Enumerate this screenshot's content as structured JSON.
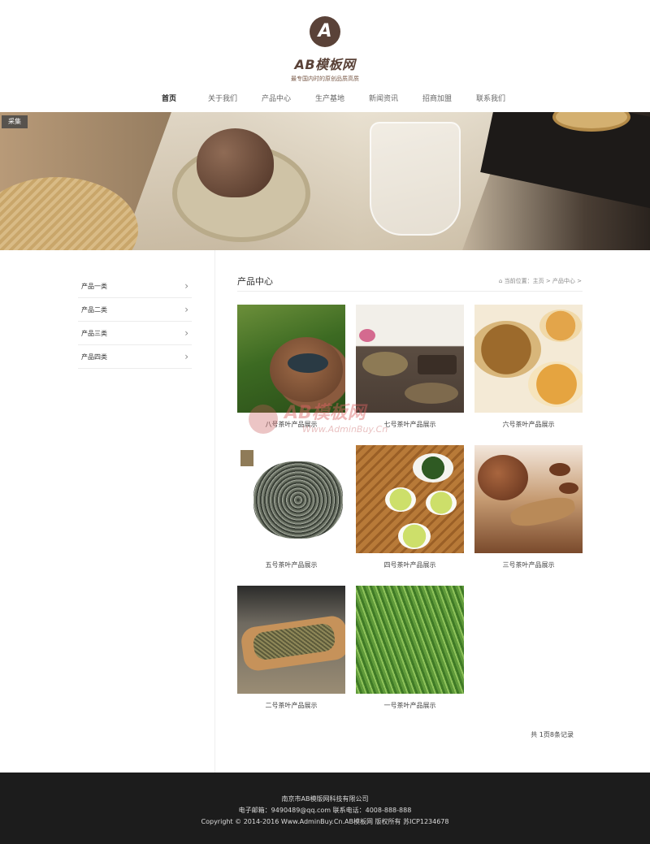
{
  "header": {
    "logo_mark": "A",
    "logo_name": "AB模板网",
    "logo_slogan": "最专国内时的原创品质高质"
  },
  "nav": [
    {
      "label": "首页",
      "active": true
    },
    {
      "label": "关于我们"
    },
    {
      "label": "产品中心"
    },
    {
      "label": "生产基地"
    },
    {
      "label": "新闻资讯"
    },
    {
      "label": "招商加盟"
    },
    {
      "label": "联系我们"
    }
  ],
  "banner": {
    "tag": "采集"
  },
  "sidebar": {
    "items": [
      {
        "label": "产品一类"
      },
      {
        "label": "产品二类"
      },
      {
        "label": "产品三类"
      },
      {
        "label": "产品四类"
      }
    ]
  },
  "content": {
    "title": "产品中心",
    "breadcrumb": "当前位置：主页 > 产品中心 >"
  },
  "products": [
    {
      "caption": "八号茶叶产品展示",
      "theme": "teapot-green"
    },
    {
      "caption": "七号茶叶产品展示",
      "theme": "tea-ceremony"
    },
    {
      "caption": "六号茶叶产品展示",
      "theme": "yellow-tea-cups"
    },
    {
      "caption": "五号茶叶产品展示",
      "theme": "dark-loose-leaf"
    },
    {
      "caption": "四号茶叶产品展示",
      "theme": "green-tea-cups"
    },
    {
      "caption": "三号茶叶产品展示",
      "theme": "clay-teapot"
    },
    {
      "caption": "二号茶叶产品展示",
      "theme": "wooden-scoop"
    },
    {
      "caption": "一号茶叶产品展示",
      "theme": "green-needles"
    }
  ],
  "watermark": {
    "text": "AB模板网",
    "url": "Www.AdminBuy.Cn"
  },
  "pager": {
    "text": "共 1页8条记录"
  },
  "footer": {
    "company": "南京市AB模版网科技有限公司",
    "contact": "电子邮箱：9490489@qq.com    联系电话：4008-888-888",
    "copyright": "Copyright © 2014-2016 Www.AdminBuy.Cn.AB模板网 版权所有    苏ICP1234678"
  },
  "colors": {
    "brand": "#5a4238",
    "footer_bg": "#1c1c1c"
  },
  "icons": {
    "sidebar_chevron": "chevron-right-icon",
    "breadcrumb_home": "home-icon"
  }
}
